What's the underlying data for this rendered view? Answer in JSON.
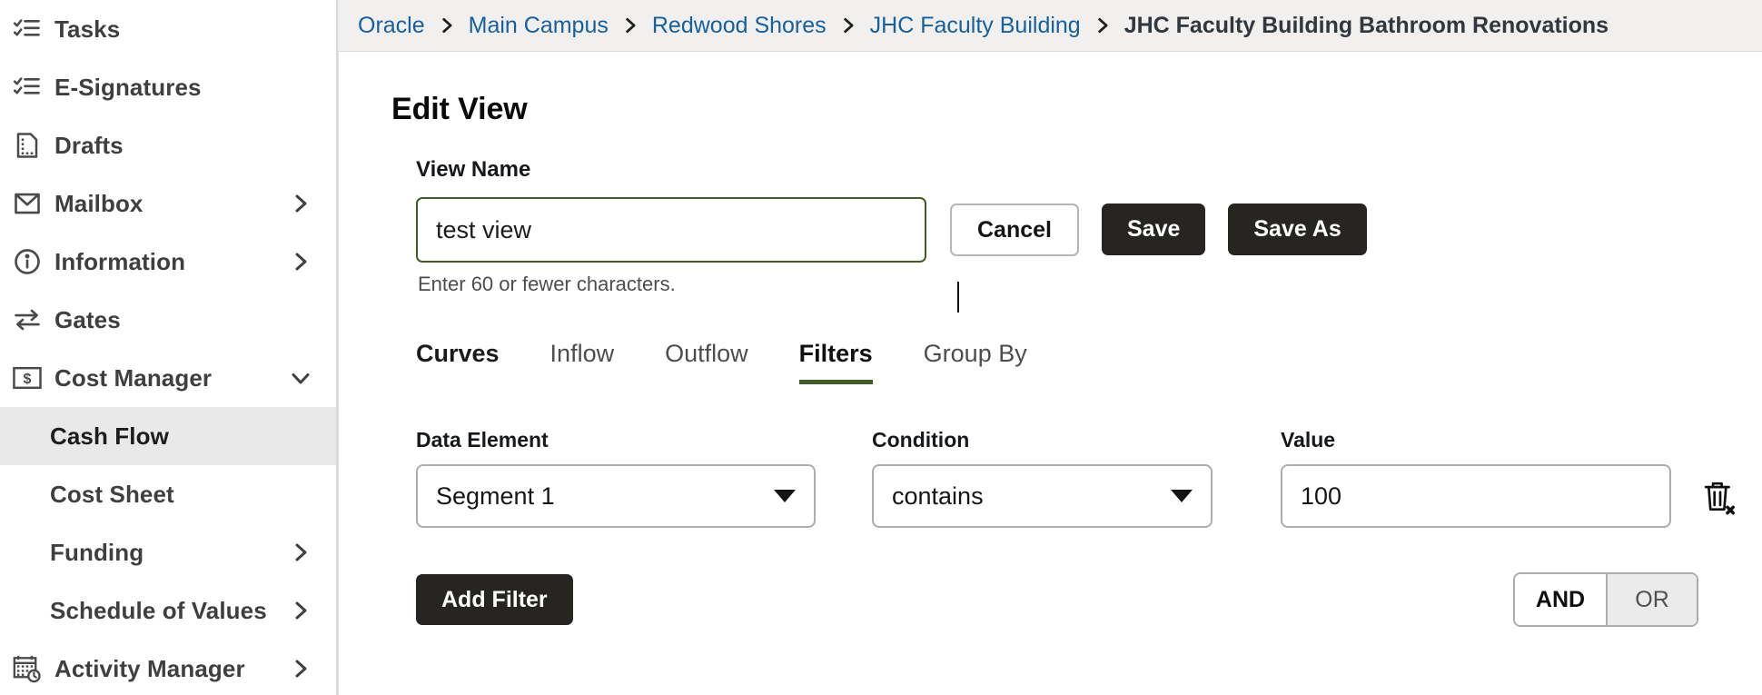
{
  "sidebar": {
    "items": [
      {
        "label": "Tasks",
        "icon": "checklist-icon",
        "expandable": false,
        "active": false,
        "sub": false
      },
      {
        "label": "E-Signatures",
        "icon": "checklist-icon",
        "expandable": false,
        "active": false,
        "sub": false
      },
      {
        "label": "Drafts",
        "icon": "document-icon",
        "expandable": false,
        "active": false,
        "sub": false
      },
      {
        "label": "Mailbox",
        "icon": "envelope-icon",
        "expandable": true,
        "active": false,
        "sub": false
      },
      {
        "label": "Information",
        "icon": "info-circle-icon",
        "expandable": true,
        "active": false,
        "sub": false
      },
      {
        "label": "Gates",
        "icon": "exchange-arrows-icon",
        "expandable": false,
        "active": false,
        "sub": false
      },
      {
        "label": "Cost Manager",
        "icon": "dollar-box-icon",
        "expandable": true,
        "expanded": true,
        "active": false,
        "sub": false
      },
      {
        "label": "Cash Flow",
        "icon": "",
        "expandable": false,
        "active": true,
        "sub": true
      },
      {
        "label": "Cost Sheet",
        "icon": "",
        "expandable": false,
        "active": false,
        "sub": true
      },
      {
        "label": "Funding",
        "icon": "",
        "expandable": true,
        "active": false,
        "sub": true
      },
      {
        "label": "Schedule of Values",
        "icon": "",
        "expandable": true,
        "active": false,
        "sub": true
      },
      {
        "label": "Activity Manager",
        "icon": "calendar-clock-icon",
        "expandable": true,
        "active": false,
        "sub": false
      }
    ]
  },
  "breadcrumb": {
    "items": [
      {
        "label": "Oracle",
        "current": false
      },
      {
        "label": "Main Campus",
        "current": false
      },
      {
        "label": "Redwood Shores",
        "current": false
      },
      {
        "label": "JHC Faculty Building",
        "current": false
      },
      {
        "label": "JHC Faculty Building Bathroom Renovations",
        "current": true
      }
    ]
  },
  "page": {
    "title": "Edit View",
    "view_name_label": "View Name",
    "view_name_value": "test view",
    "view_name_placeholder": "",
    "hint": "Enter 60 or fewer characters.",
    "buttons": {
      "cancel": "Cancel",
      "save": "Save",
      "save_as": "Save As"
    }
  },
  "tabs": [
    {
      "label": "Curves",
      "active": false,
      "bold": true
    },
    {
      "label": "Inflow",
      "active": false,
      "bold": false
    },
    {
      "label": "Outflow",
      "active": false,
      "bold": false
    },
    {
      "label": "Filters",
      "active": true,
      "bold": true
    },
    {
      "label": "Group By",
      "active": false,
      "bold": false
    }
  ],
  "filters": {
    "columns": {
      "data_element": "Data Element",
      "condition": "Condition",
      "value": "Value"
    },
    "rows": [
      {
        "data_element": "Segment 1",
        "condition": "contains",
        "value": "100",
        "delete_icon": "trash-delete-icon"
      }
    ],
    "add_filter_label": "Add Filter",
    "logic_toggle": {
      "and_label": "AND",
      "or_label": "OR",
      "selected": "AND"
    }
  },
  "colors": {
    "accent_green": "#3f5c29",
    "link_blue": "#16609e",
    "button_dark": "#262522",
    "breadcrumb_bg": "#f1f0ee",
    "active_nav_bg": "#e9e9e9"
  }
}
